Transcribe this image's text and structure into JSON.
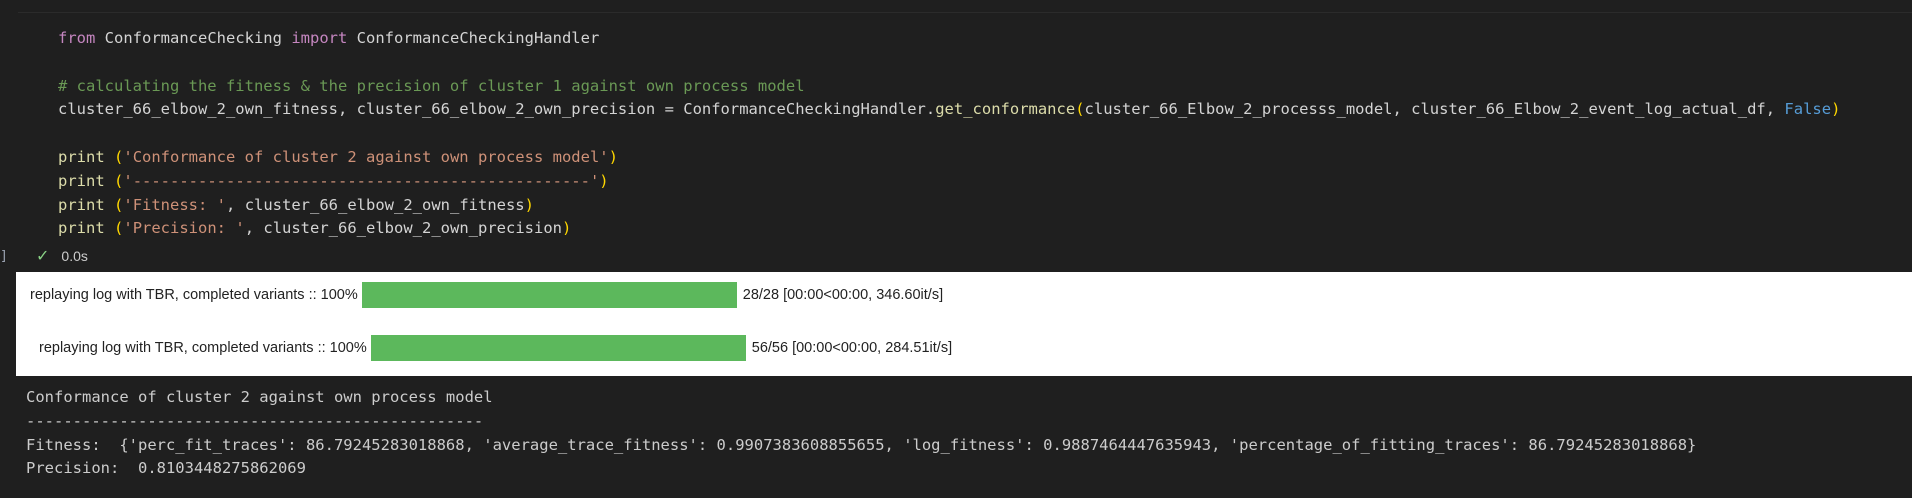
{
  "gutter": {
    "marker": "]"
  },
  "code": {
    "kw_from": "from",
    "module": "ConformanceChecking",
    "kw_import": "import",
    "handler": "ConformanceCheckingHandler",
    "comment": "# calculating the fitness & the precision of cluster 1 against own process model",
    "assign_vars": "cluster_66_elbow_2_own_fitness, cluster_66_elbow_2_own_precision",
    "assign_eq": " = ",
    "call_obj": "ConformanceCheckingHandler.",
    "call_fn": "get_conformance",
    "arg1": "cluster_66_Elbow_2_processs_model, cluster_66_Elbow_2_event_log_actual_df, ",
    "arg_false": "False",
    "print_kw": "print",
    "str_title": "'Conformance of cluster 2 against own process model'",
    "str_sep": "'-------------------------------------------------'",
    "str_fitness": "'Fitness: '",
    "var_fitness": "cluster_66_elbow_2_own_fitness",
    "str_precision": "'Precision: '",
    "var_precision": "cluster_66_elbow_2_own_precision"
  },
  "status": {
    "icon": "check-icon",
    "duration": "0.0s"
  },
  "progress": [
    {
      "label": "replaying log with TBR, completed variants :: 100%",
      "fraction": 1.0,
      "stats": "28/28 [00:00<00:00, 346.60it/s]"
    },
    {
      "label": "replaying log with TBR, completed variants :: 100%",
      "fraction": 1.0,
      "stats": "56/56 [00:00<00:00, 284.51it/s]"
    }
  ],
  "output": {
    "line1": "Conformance of cluster 2 against own process model",
    "line2": "-------------------------------------------------",
    "line3": "Fitness:  {'perc_fit_traces': 86.79245283018868, 'average_trace_fitness': 0.9907383608855655, 'log_fitness': 0.9887464447635943, 'percentage_of_fitting_traces': 86.79245283018868}",
    "line4": "Precision:  0.8103448275862069"
  },
  "colors": {
    "bar_fill": "#5cb85c",
    "background": "#1f1f1f",
    "progress_bg": "#ffffff"
  }
}
